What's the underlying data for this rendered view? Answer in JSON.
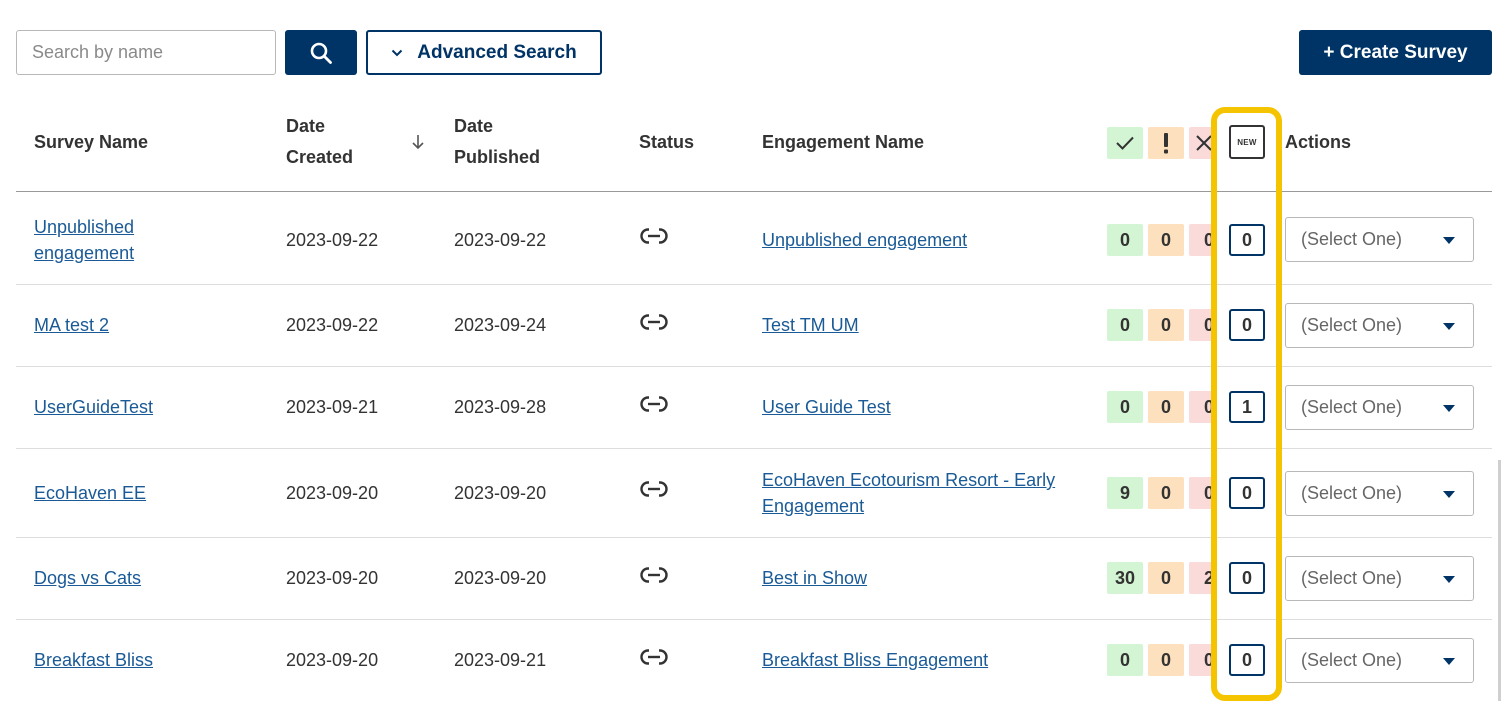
{
  "toolbar": {
    "search_placeholder": "Search by name",
    "advanced_search_label": "Advanced Search",
    "create_label": "+ Create Survey"
  },
  "table": {
    "headers": {
      "survey_name": "Survey Name",
      "date_created_1": "Date",
      "date_created_2": "Created",
      "date_published_1": "Date",
      "date_published_2": "Published",
      "status": "Status",
      "engagement_name": "Engagement Name",
      "new_badge": "NEW",
      "actions": "Actions"
    },
    "sort": {
      "column": "Date Created",
      "direction": "descending",
      "icon": "arrow-down-icon"
    },
    "rows": [
      {
        "survey": "Unpublished engagement",
        "created": "2023-09-22",
        "published": "2023-09-22",
        "engagement": "Unpublished engagement",
        "approved": "0",
        "needs_review": "0",
        "rejected": "0",
        "new": "0",
        "action": "(Select One)"
      },
      {
        "survey": "MA test 2",
        "created": "2023-09-22",
        "published": "2023-09-24",
        "engagement": "Test TM UM",
        "approved": "0",
        "needs_review": "0",
        "rejected": "0",
        "new": "0",
        "action": "(Select One)"
      },
      {
        "survey": "UserGuideTest",
        "created": "2023-09-21",
        "published": "2023-09-28",
        "engagement": "User Guide Test",
        "approved": "0",
        "needs_review": "0",
        "rejected": "0",
        "new": "1",
        "action": "(Select One)"
      },
      {
        "survey": "EcoHaven EE",
        "created": "2023-09-20",
        "published": "2023-09-20",
        "engagement": "EcoHaven Ecotourism Resort - Early Engagement",
        "approved": "9",
        "needs_review": "0",
        "rejected": "0",
        "new": "0",
        "action": "(Select One)"
      },
      {
        "survey": "Dogs vs Cats",
        "created": "2023-09-20",
        "published": "2023-09-20",
        "engagement": "Best in Show",
        "approved": "30",
        "needs_review": "0",
        "rejected": "2",
        "new": "0",
        "action": "(Select One)"
      },
      {
        "survey": "Breakfast Bliss",
        "created": "2023-09-20",
        "published": "2023-09-21",
        "engagement": "Breakfast Bliss Engagement",
        "approved": "0",
        "needs_review": "0",
        "rejected": "0",
        "new": "0",
        "action": "(Select One)"
      }
    ]
  },
  "colors": {
    "primary": "#003366",
    "link": "#1a5a96",
    "approved_bg": "#d3f5d3",
    "needs_review_bg": "#fde0bd",
    "rejected_bg": "#fbdada",
    "highlight": "#f5c400"
  },
  "icons": {
    "search": "search-icon",
    "advanced": "chevron-down-icon",
    "status": "link-icon",
    "approved": "check-icon",
    "needs_review": "exclamation-icon",
    "rejected": "close-icon"
  }
}
